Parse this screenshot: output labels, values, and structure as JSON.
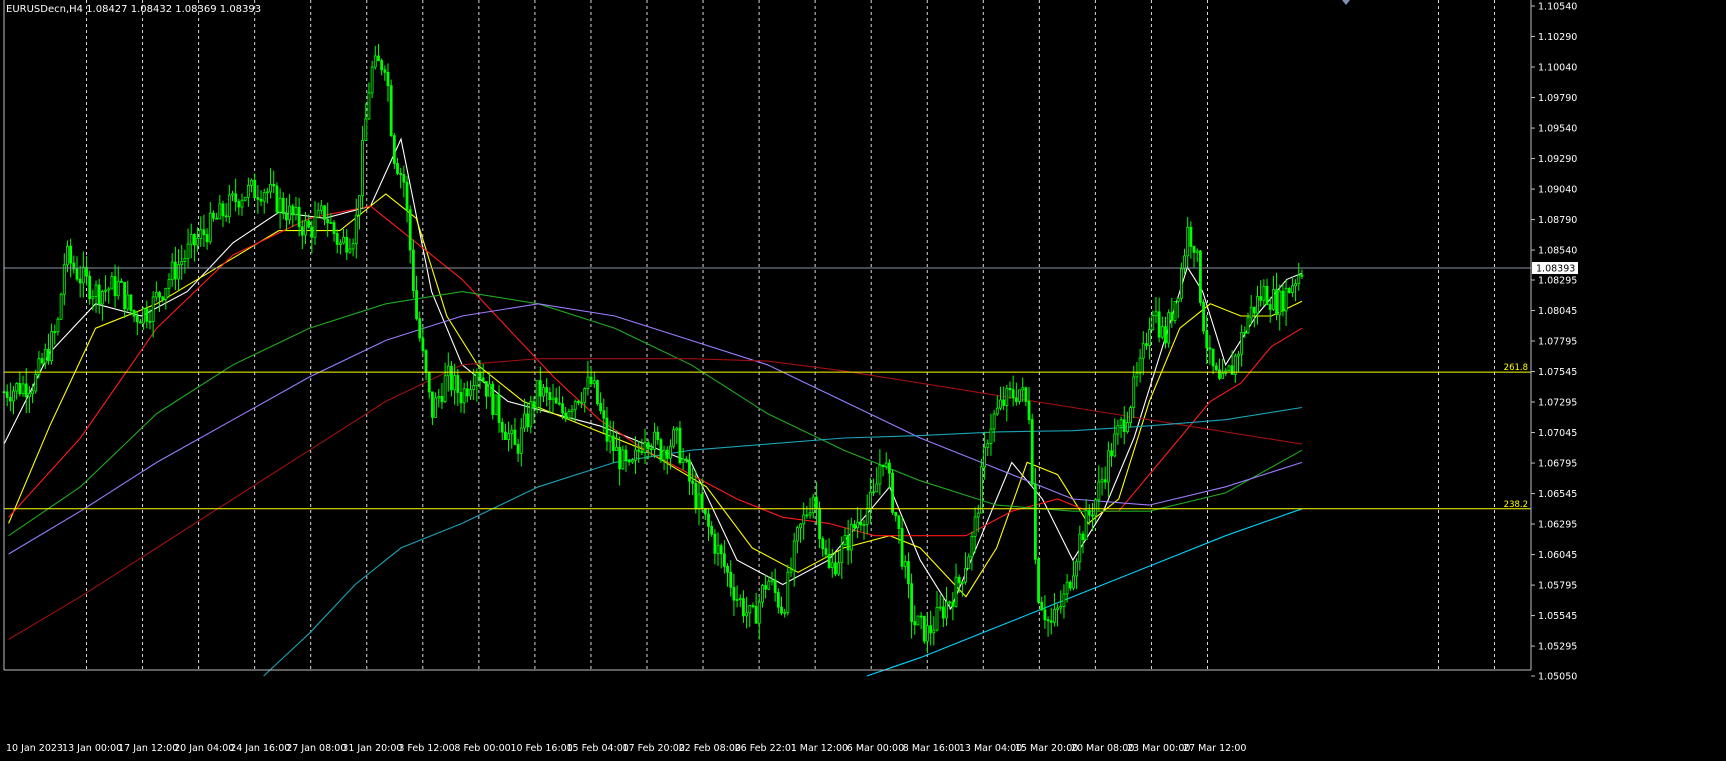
{
  "header": {
    "symbol_label": "EURUSDecn,H4  1.08427 1.08432 1.08369 1.08393"
  },
  "colors": {
    "background": "#000000",
    "grid": "#ffffff",
    "axis": "#c0c0c0",
    "candle": "#00ff00",
    "fib_line": "#ffff00",
    "bid_line": "#8a94a6",
    "ma_white": "#ffffff",
    "ma_yellow": "#ffff00",
    "ma_red": "#ff1a1a",
    "ma_green": "#1faa1f",
    "ma_violet": "#9d7bff",
    "ma_darkred": "#a01010",
    "ma_teal": "#1aa3b5",
    "ma_cyan": "#00d5ff"
  },
  "chart_data": {
    "type": "candlestick",
    "ylim": [
      1.0505,
      1.1054
    ],
    "y_ticks": [
      "1.10540",
      "1.10290",
      "1.10040",
      "1.09790",
      "1.09540",
      "1.09290",
      "1.09040",
      "1.08790",
      "1.08540",
      "1.08295",
      "1.08045",
      "1.07795",
      "1.07545",
      "1.07295",
      "1.07045",
      "1.06795",
      "1.06545",
      "1.06295",
      "1.06045",
      "1.05795",
      "1.05545",
      "1.05295",
      "1.05050"
    ],
    "x_labels": [
      "10 Jan 2023",
      "13 Jan 00:00",
      "17 Jan 12:00",
      "20 Jan 04:00",
      "24 Jan 16:00",
      "27 Jan 08:00",
      "31 Jan 20:00",
      "3 Feb 12:00",
      "8 Feb 00:00",
      "10 Feb 16:00",
      "15 Feb 04:00",
      "17 Feb 20:00",
      "22 Feb 08:00",
      "26 Feb 22:01",
      "1 Mar 12:00",
      "6 Mar 00:00",
      "8 Mar 16:00",
      "13 Mar 04:00",
      "15 Mar 20:00",
      "20 Mar 08:00",
      "23 Mar 00:00",
      "27 Mar 12:00"
    ],
    "current_price": "1.08393",
    "fib_levels": [
      {
        "label": "261.8",
        "price": 1.0754
      },
      {
        "label": "238.2",
        "price": 1.0642
      }
    ],
    "close_path": [
      [
        0,
        1.0738
      ],
      [
        0.02,
        1.0746
      ],
      [
        0.035,
        1.079
      ],
      [
        0.04,
        1.085
      ],
      [
        0.05,
        1.0832
      ],
      [
        0.06,
        1.082
      ],
      [
        0.075,
        1.0825
      ],
      [
        0.085,
        1.08
      ],
      [
        0.095,
        1.0805
      ],
      [
        0.11,
        1.0835
      ],
      [
        0.125,
        1.086
      ],
      [
        0.14,
        1.088
      ],
      [
        0.155,
        1.09
      ],
      [
        0.17,
        1.0905
      ],
      [
        0.19,
        1.088
      ],
      [
        0.2,
        1.087
      ],
      [
        0.21,
        1.0885
      ],
      [
        0.22,
        1.0858
      ],
      [
        0.23,
        1.087
      ],
      [
        0.24,
        1.1
      ],
      [
        0.25,
        1.101
      ],
      [
        0.255,
        1.0935
      ],
      [
        0.262,
        1.091
      ],
      [
        0.27,
        1.08
      ],
      [
        0.28,
        1.072
      ],
      [
        0.29,
        1.075
      ],
      [
        0.3,
        1.0735
      ],
      [
        0.31,
        1.076
      ],
      [
        0.32,
        1.073
      ],
      [
        0.335,
        1.069
      ],
      [
        0.35,
        1.074
      ],
      [
        0.365,
        1.072
      ],
      [
        0.375,
        1.0735
      ],
      [
        0.385,
        1.0745
      ],
      [
        0.395,
        1.07
      ],
      [
        0.41,
        1.067
      ],
      [
        0.42,
        1.0705
      ],
      [
        0.43,
        1.069
      ],
      [
        0.44,
        1.07
      ],
      [
        0.45,
        1.066
      ],
      [
        0.46,
        1.063
      ],
      [
        0.47,
        1.06
      ],
      [
        0.48,
        1.057
      ],
      [
        0.49,
        1.055
      ],
      [
        0.5,
        1.0585
      ],
      [
        0.51,
        1.056
      ],
      [
        0.52,
        1.062
      ],
      [
        0.53,
        1.0655
      ],
      [
        0.54,
        1.059
      ],
      [
        0.55,
        1.061
      ],
      [
        0.56,
        1.0635
      ],
      [
        0.57,
        1.065
      ],
      [
        0.575,
        1.069
      ],
      [
        0.585,
        1.063
      ],
      [
        0.595,
        1.055
      ],
      [
        0.605,
        1.054
      ],
      [
        0.615,
        1.056
      ],
      [
        0.625,
        1.058
      ],
      [
        0.635,
        1.062
      ],
      [
        0.645,
        1.071
      ],
      [
        0.655,
        1.073
      ],
      [
        0.665,
        1.074
      ],
      [
        0.672,
        1.072
      ],
      [
        0.676,
        1.058
      ],
      [
        0.685,
        1.0545
      ],
      [
        0.695,
        1.057
      ],
      [
        0.705,
        1.062
      ],
      [
        0.715,
        1.065
      ],
      [
        0.725,
        1.069
      ],
      [
        0.735,
        1.072
      ],
      [
        0.745,
        1.076
      ],
      [
        0.752,
        1.081
      ],
      [
        0.76,
        1.078
      ],
      [
        0.77,
        1.083
      ],
      [
        0.775,
        1.087
      ],
      [
        0.78,
        1.086
      ],
      [
        0.785,
        1.08
      ],
      [
        0.79,
        1.076
      ],
      [
        0.797,
        1.074
      ],
      [
        0.805,
        1.076
      ],
      [
        0.815,
        1.08
      ],
      [
        0.825,
        1.082
      ],
      [
        0.835,
        1.081
      ],
      [
        0.845,
        1.083
      ],
      [
        0.85,
        1.0839
      ]
    ],
    "moving_averages": [
      {
        "color_key": "ma_white",
        "points": [
          [
            0,
            1.0695
          ],
          [
            0.03,
            1.077
          ],
          [
            0.06,
            1.081
          ],
          [
            0.09,
            1.08
          ],
          [
            0.12,
            1.082
          ],
          [
            0.15,
            1.086
          ],
          [
            0.18,
            1.0885
          ],
          [
            0.21,
            1.088
          ],
          [
            0.24,
            1.089
          ],
          [
            0.26,
            1.0945
          ],
          [
            0.28,
            1.082
          ],
          [
            0.3,
            1.076
          ],
          [
            0.33,
            1.073
          ],
          [
            0.36,
            1.072
          ],
          [
            0.39,
            1.071
          ],
          [
            0.42,
            1.0695
          ],
          [
            0.45,
            1.068
          ],
          [
            0.48,
            1.06
          ],
          [
            0.51,
            1.058
          ],
          [
            0.54,
            1.06
          ],
          [
            0.56,
            1.063
          ],
          [
            0.58,
            1.066
          ],
          [
            0.6,
            1.06
          ],
          [
            0.62,
            1.056
          ],
          [
            0.64,
            1.062
          ],
          [
            0.66,
            1.068
          ],
          [
            0.68,
            1.065
          ],
          [
            0.7,
            1.06
          ],
          [
            0.72,
            1.064
          ],
          [
            0.74,
            1.07
          ],
          [
            0.76,
            1.078
          ],
          [
            0.775,
            1.084
          ],
          [
            0.785,
            1.082
          ],
          [
            0.8,
            1.076
          ],
          [
            0.82,
            1.08
          ],
          [
            0.84,
            1.083
          ],
          [
            0.85,
            1.0835
          ]
        ]
      },
      {
        "color_key": "ma_yellow",
        "points": [
          [
            0.003,
            1.063
          ],
          [
            0.03,
            1.071
          ],
          [
            0.06,
            1.079
          ],
          [
            0.1,
            1.081
          ],
          [
            0.14,
            1.084
          ],
          [
            0.18,
            1.087
          ],
          [
            0.22,
            1.087
          ],
          [
            0.25,
            1.09
          ],
          [
            0.27,
            1.088
          ],
          [
            0.29,
            1.08
          ],
          [
            0.31,
            1.076
          ],
          [
            0.34,
            1.073
          ],
          [
            0.38,
            1.071
          ],
          [
            0.42,
            1.069
          ],
          [
            0.46,
            1.066
          ],
          [
            0.49,
            1.061
          ],
          [
            0.52,
            1.059
          ],
          [
            0.55,
            1.061
          ],
          [
            0.58,
            1.062
          ],
          [
            0.6,
            1.061
          ],
          [
            0.63,
            1.057
          ],
          [
            0.65,
            1.061
          ],
          [
            0.67,
            1.068
          ],
          [
            0.69,
            1.067
          ],
          [
            0.71,
            1.063
          ],
          [
            0.73,
            1.065
          ],
          [
            0.75,
            1.073
          ],
          [
            0.77,
            1.079
          ],
          [
            0.79,
            1.081
          ],
          [
            0.81,
            1.08
          ],
          [
            0.83,
            1.08
          ],
          [
            0.85,
            1.0812
          ]
        ]
      },
      {
        "color_key": "ma_red",
        "points": [
          [
            0.003,
            1.0635
          ],
          [
            0.05,
            1.07
          ],
          [
            0.1,
            1.079
          ],
          [
            0.15,
            1.085
          ],
          [
            0.2,
            1.088
          ],
          [
            0.24,
            1.089
          ],
          [
            0.27,
            1.086
          ],
          [
            0.3,
            1.083
          ],
          [
            0.33,
            1.079
          ],
          [
            0.36,
            1.075
          ],
          [
            0.39,
            1.0715
          ],
          [
            0.42,
            1.069
          ],
          [
            0.45,
            1.067
          ],
          [
            0.48,
            1.065
          ],
          [
            0.51,
            1.0635
          ],
          [
            0.54,
            1.063
          ],
          [
            0.57,
            1.062
          ],
          [
            0.6,
            1.062
          ],
          [
            0.63,
            1.062
          ],
          [
            0.66,
            1.064
          ],
          [
            0.69,
            1.065
          ],
          [
            0.71,
            1.064
          ],
          [
            0.73,
            1.064
          ],
          [
            0.75,
            1.067
          ],
          [
            0.77,
            1.07
          ],
          [
            0.79,
            1.073
          ],
          [
            0.81,
            1.0745
          ],
          [
            0.83,
            1.0775
          ],
          [
            0.85,
            1.079
          ]
        ]
      },
      {
        "color_key": "ma_green",
        "points": [
          [
            0.003,
            1.062
          ],
          [
            0.05,
            1.066
          ],
          [
            0.1,
            1.072
          ],
          [
            0.15,
            1.076
          ],
          [
            0.2,
            1.079
          ],
          [
            0.25,
            1.081
          ],
          [
            0.3,
            1.082
          ],
          [
            0.35,
            1.081
          ],
          [
            0.4,
            1.079
          ],
          [
            0.45,
            1.076
          ],
          [
            0.5,
            1.072
          ],
          [
            0.55,
            1.069
          ],
          [
            0.6,
            1.0665
          ],
          [
            0.65,
            1.0645
          ],
          [
            0.7,
            1.064
          ],
          [
            0.75,
            1.064
          ],
          [
            0.8,
            1.0655
          ],
          [
            0.85,
            1.069
          ]
        ]
      },
      {
        "color_key": "ma_violet",
        "points": [
          [
            0.003,
            1.0605
          ],
          [
            0.05,
            1.064
          ],
          [
            0.1,
            1.068
          ],
          [
            0.15,
            1.0715
          ],
          [
            0.2,
            1.075
          ],
          [
            0.25,
            1.078
          ],
          [
            0.3,
            1.08
          ],
          [
            0.35,
            1.081
          ],
          [
            0.4,
            1.08
          ],
          [
            0.45,
            1.078
          ],
          [
            0.5,
            1.076
          ],
          [
            0.55,
            1.073
          ],
          [
            0.6,
            1.07
          ],
          [
            0.65,
            1.0675
          ],
          [
            0.7,
            1.065
          ],
          [
            0.75,
            1.0645
          ],
          [
            0.8,
            1.066
          ],
          [
            0.85,
            1.068
          ]
        ]
      },
      {
        "color_key": "ma_darkred",
        "points": [
          [
            0.003,
            1.0535
          ],
          [
            0.05,
            1.057
          ],
          [
            0.1,
            1.061
          ],
          [
            0.15,
            1.065
          ],
          [
            0.2,
            1.069
          ],
          [
            0.25,
            1.073
          ],
          [
            0.3,
            1.076
          ],
          [
            0.35,
            1.0765
          ],
          [
            0.4,
            1.0765
          ],
          [
            0.45,
            1.0765
          ],
          [
            0.5,
            1.0763
          ],
          [
            0.55,
            1.0755
          ],
          [
            0.6,
            1.0745
          ],
          [
            0.65,
            1.0735
          ],
          [
            0.7,
            1.0725
          ],
          [
            0.75,
            1.0715
          ],
          [
            0.8,
            1.0705
          ],
          [
            0.85,
            1.0695
          ]
        ]
      },
      {
        "color_key": "ma_teal",
        "points": [
          [
            0.17,
            1.0505
          ],
          [
            0.2,
            1.054
          ],
          [
            0.23,
            1.058
          ],
          [
            0.26,
            1.061
          ],
          [
            0.3,
            1.063
          ],
          [
            0.35,
            1.066
          ],
          [
            0.4,
            1.068
          ],
          [
            0.45,
            1.069
          ],
          [
            0.5,
            1.0695
          ],
          [
            0.55,
            1.07
          ],
          [
            0.6,
            1.0702
          ],
          [
            0.65,
            1.0705
          ],
          [
            0.7,
            1.0706
          ],
          [
            0.75,
            1.071
          ],
          [
            0.8,
            1.0715
          ],
          [
            0.85,
            1.0725
          ]
        ]
      },
      {
        "color_key": "ma_cyan",
        "points": [
          [
            0.565,
            1.0505
          ],
          [
            0.6,
            1.052
          ],
          [
            0.64,
            1.054
          ],
          [
            0.68,
            1.056
          ],
          [
            0.72,
            1.058
          ],
          [
            0.76,
            1.06
          ],
          [
            0.8,
            1.062
          ],
          [
            0.85,
            1.0642
          ]
        ]
      }
    ]
  }
}
